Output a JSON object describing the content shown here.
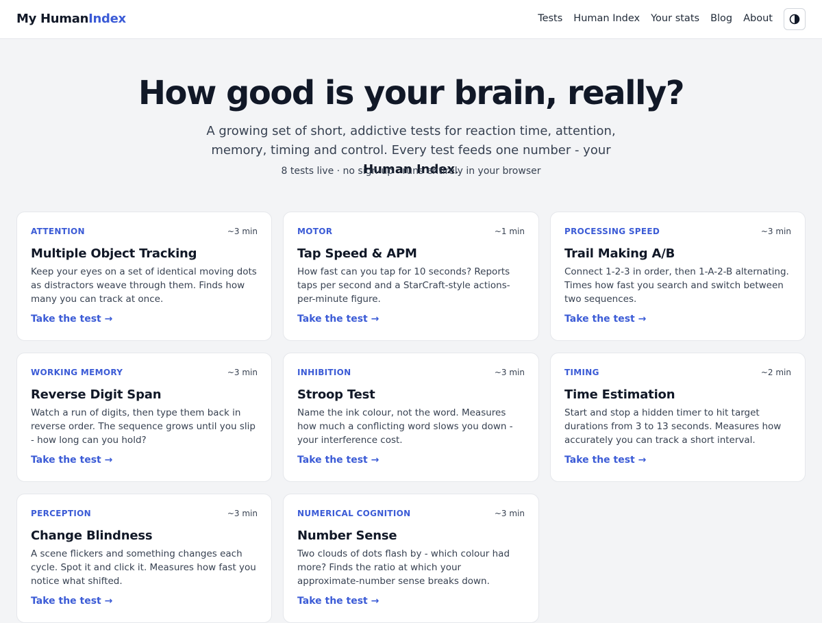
{
  "brand": {
    "part1": "My Human",
    "part2": "Index"
  },
  "nav": [
    "Tests",
    "Human Index",
    "Your stats",
    "Blog",
    "About"
  ],
  "hero": {
    "title": "How good is your brain, really?",
    "subtitle_pre": "A growing set of short, addictive tests for reaction time, attention, memory, timing and control. Every test feeds one number - your ",
    "subtitle_bold": "Human Index",
    "subtitle_post": ".",
    "meta": "8 tests live · no sign-up · runs entirely in your browser"
  },
  "cards": [
    {
      "category": "Attention",
      "duration": "~3 min",
      "title": "Multiple Object Tracking",
      "desc": "Keep your eyes on a set of identical moving dots as distractors weave through them. Finds how many you can track at once.",
      "cta": "Take the test →"
    },
    {
      "category": "Motor",
      "duration": "~1 min",
      "title": "Tap Speed & APM",
      "desc": "How fast can you tap for 10 seconds? Reports taps per second and a StarCraft-style actions-per-minute figure.",
      "cta": "Take the test →"
    },
    {
      "category": "Processing Speed",
      "duration": "~3 min",
      "title": "Trail Making A/B",
      "desc": "Connect 1-2-3 in order, then 1-A-2-B alternating. Times how fast you search and switch between two sequences.",
      "cta": "Take the test →"
    },
    {
      "category": "Working Memory",
      "duration": "~3 min",
      "title": "Reverse Digit Span",
      "desc": "Watch a run of digits, then type them back in reverse order. The sequence grows until you slip - how long can you hold?",
      "cta": "Take the test →"
    },
    {
      "category": "Inhibition",
      "duration": "~3 min",
      "title": "Stroop Test",
      "desc": "Name the ink colour, not the word. Measures how much a conflicting word slows you down - your interference cost.",
      "cta": "Take the test →"
    },
    {
      "category": "Timing",
      "duration": "~2 min",
      "title": "Time Estimation",
      "desc": "Start and stop a hidden timer to hit target durations from 3 to 13 seconds. Measures how accurately you can track a short interval.",
      "cta": "Take the test →"
    },
    {
      "category": "Perception",
      "duration": "~3 min",
      "title": "Change Blindness",
      "desc": "A scene flickers and something changes each cycle. Spot it and click it. Measures how fast you notice what shifted.",
      "cta": "Take the test →"
    },
    {
      "category": "Numerical Cognition",
      "duration": "~3 min",
      "title": "Number Sense",
      "desc": "Two clouds of dots flash by - which colour had more? Finds the ratio at which your approximate-number sense breaks down.",
      "cta": "Take the test →"
    }
  ],
  "icons": {
    "theme_toggle": "half-circle-icon"
  },
  "colors": {
    "accent": "#3b5bd6",
    "background": "#f3f4f6",
    "card": "#ffffff"
  }
}
